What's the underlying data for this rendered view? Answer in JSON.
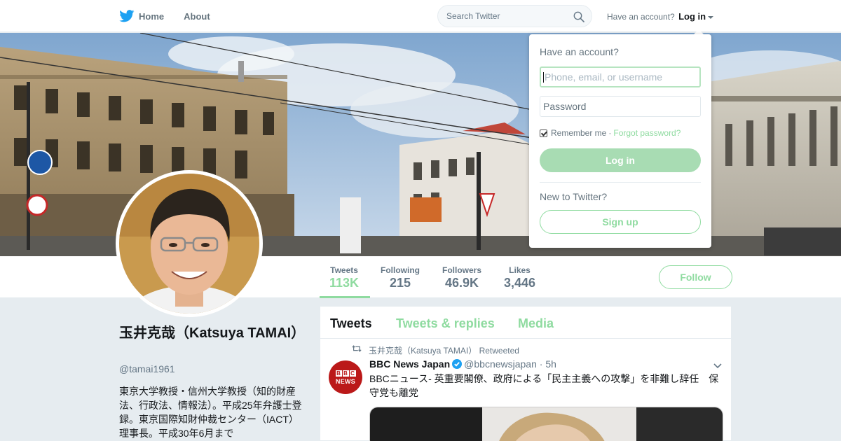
{
  "nav": {
    "home_label": "Home",
    "about_label": "About",
    "search_placeholder": "Search Twitter",
    "account_prompt": "Have an account?",
    "login_label": "Log in"
  },
  "profile": {
    "name": "玉井克哉（Katsuya TAMAI）",
    "handle": "@tamai1961",
    "bio": "東京大学教授・信州大学教授（知的財産法、行政法、情報法）。平成25年弁護士登録。東京国際知財仲裁センター（IACT）理事長。平成30年6月まで",
    "follow_label": "Follow"
  },
  "stats": [
    {
      "label": "Tweets",
      "value": "113K",
      "active": true
    },
    {
      "label": "Following",
      "value": "215",
      "active": false
    },
    {
      "label": "Followers",
      "value": "46.9K",
      "active": false
    },
    {
      "label": "Likes",
      "value": "3,446",
      "active": false
    }
  ],
  "timeline": {
    "tabs": [
      "Tweets",
      "Tweets & replies",
      "Media"
    ],
    "active_tab": "Tweets",
    "tweet": {
      "retweeted_by": "玉井克哉（Katsuya TAMAI） Retweeted",
      "author_name": "BBC News Japan",
      "author_handle": "@bbcnewsjapan",
      "separator": "·",
      "time": "5h",
      "text": "BBCニュース- 英重要閣僚、政府による「民主主義への攻撃」を非難し辞任　保守党も離党",
      "avatar_letters": [
        "B",
        "B",
        "C"
      ],
      "avatar_word": "NEWS"
    }
  },
  "login_dropdown": {
    "title": "Have an account?",
    "username_placeholder": "Phone, email, or username",
    "password_placeholder": "Password",
    "remember_label": "Remember me",
    "separator": "·",
    "forgot_label": "Forgot password?",
    "login_button": "Log in",
    "new_prompt": "New to Twitter?",
    "signup_button": "Sign up"
  },
  "colors": {
    "accent": "#8fdba0",
    "twitter_blue": "#1da1f2",
    "bbc_red": "#bb1919"
  }
}
